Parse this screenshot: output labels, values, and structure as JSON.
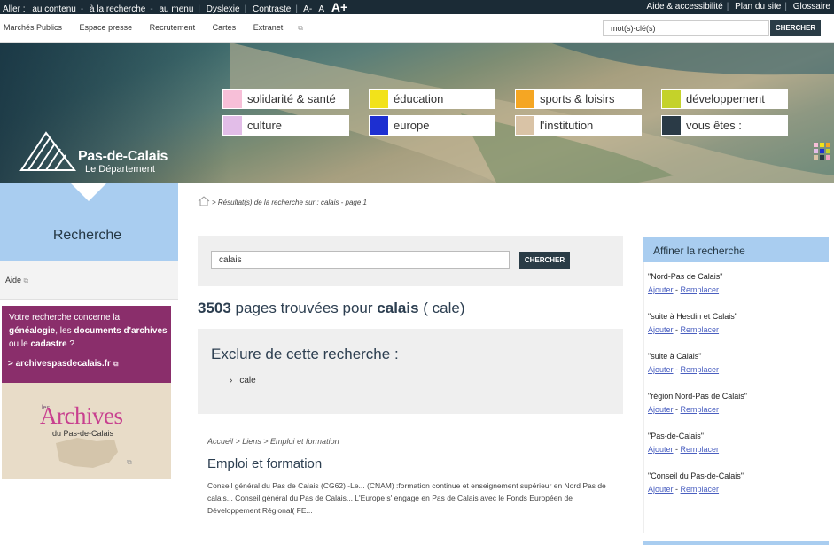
{
  "topbar": {
    "aller": "Aller :",
    "links": [
      "au contenu",
      "à la recherche",
      "au menu"
    ],
    "dyslexie": "Dyslexie",
    "contraste": "Contraste",
    "font_small": "A-",
    "font_normal": "A",
    "font_large": "A+",
    "right_links": [
      "Aide & accessibilité",
      "Plan du site",
      "Glossaire"
    ]
  },
  "utilnav": {
    "links": [
      "Marchés Publics",
      "Espace presse",
      "Recrutement",
      "Cartes",
      "Extranet"
    ],
    "search_value": "mot(s)-clé(s)",
    "search_button": "CHERCHER"
  },
  "logo": {
    "name": "Pas-de-Calais",
    "subtitle": "Le Département"
  },
  "menu": [
    {
      "label": "solidarité & santé",
      "color": "#f7bfd8"
    },
    {
      "label": "éducation",
      "color": "#f2e21a"
    },
    {
      "label": "sports & loisirs",
      "color": "#f5a623"
    },
    {
      "label": "développement",
      "color": "#c4d22a"
    },
    {
      "label": "culture",
      "color": "#e2bde8"
    },
    {
      "label": "europe",
      "color": "#1d2fd1"
    },
    {
      "label": "l'institution",
      "color": "#d9c3a6"
    },
    {
      "label": "vous êtes :",
      "color": "#2a3a46"
    }
  ],
  "sidebar": {
    "title": "Recherche",
    "aide": "Aide",
    "promo_line1": "Votre recherche concerne la",
    "promo_genealogie": "généalogie",
    "promo_line2": ", les",
    "promo_documents": "documents d'archives",
    "promo_line3": "ou le",
    "promo_cadastre": "cadastre",
    "promo_line4": " ?",
    "promo_link": "> archivespasdecalais.fr",
    "archives_les": "les",
    "archives_title": "Archives",
    "archives_sub": "du Pas-de-Calais"
  },
  "breadcrumb": "> Résultat(s) de la recherche sur : calais - page 1",
  "search": {
    "value": "calais",
    "button": "CHERCHER"
  },
  "results": {
    "count": "3503",
    "text": " pages trouvées pour ",
    "term": "calais",
    "variant": " ( cale)"
  },
  "exclude": {
    "title": "Exclure de cette recherche :",
    "items": [
      "cale"
    ]
  },
  "result_item": {
    "breadcrumb": "Accueil > Liens > Emploi et formation",
    "title": "Emploi et formation",
    "description": "Conseil général du Pas de Calais (CG62) -Le... (CNAM) :formation continue et enseignement supérieur en Nord Pas de calais... Conseil général du Pas de Calais... L'Europe s' engage en Pas de Calais avec le Fonds Européen de Développement Régional( FE..."
  },
  "refine": {
    "title": "Affiner la recherche",
    "add_label": "Ajouter",
    "replace_label": "Remplacer",
    "suggestions": [
      "\"Nord-Pas de Calais\"",
      "\"suite à Hesdin et Calais\"",
      "\"suite à Calais\"",
      "\"région Nord-Pas de Calais\"",
      "\"Pas-de-Calais\"",
      "\"Conseil du Pas-de-Calais\""
    ]
  }
}
